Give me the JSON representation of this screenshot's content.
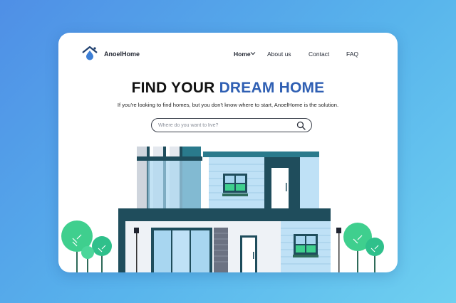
{
  "brand": {
    "name": "AnoelHome"
  },
  "nav": {
    "items": [
      {
        "label": "Home"
      },
      {
        "label": "About us"
      },
      {
        "label": "Contact"
      },
      {
        "label": "FAQ"
      }
    ]
  },
  "hero": {
    "title_main": "FIND YOUR ",
    "title_accent": "DREAM HOME",
    "subtitle": "If you're looking to find homes, but you don't know where to start, AnoelHome is the solution."
  },
  "search": {
    "placeholder": "Where do you want to live?",
    "value": ""
  },
  "colors": {
    "background_start": "#4f8fe6",
    "background_end": "#6fd0f0",
    "accent": "#2f5fb3",
    "house_dark": "#1f4d5c",
    "house_teal": "#2a7a8c",
    "tree_green": "#3fcf8e"
  },
  "icons": {
    "logo": "house-drop-icon",
    "nav_chevron": "chevron-down-icon",
    "search": "search-icon"
  }
}
